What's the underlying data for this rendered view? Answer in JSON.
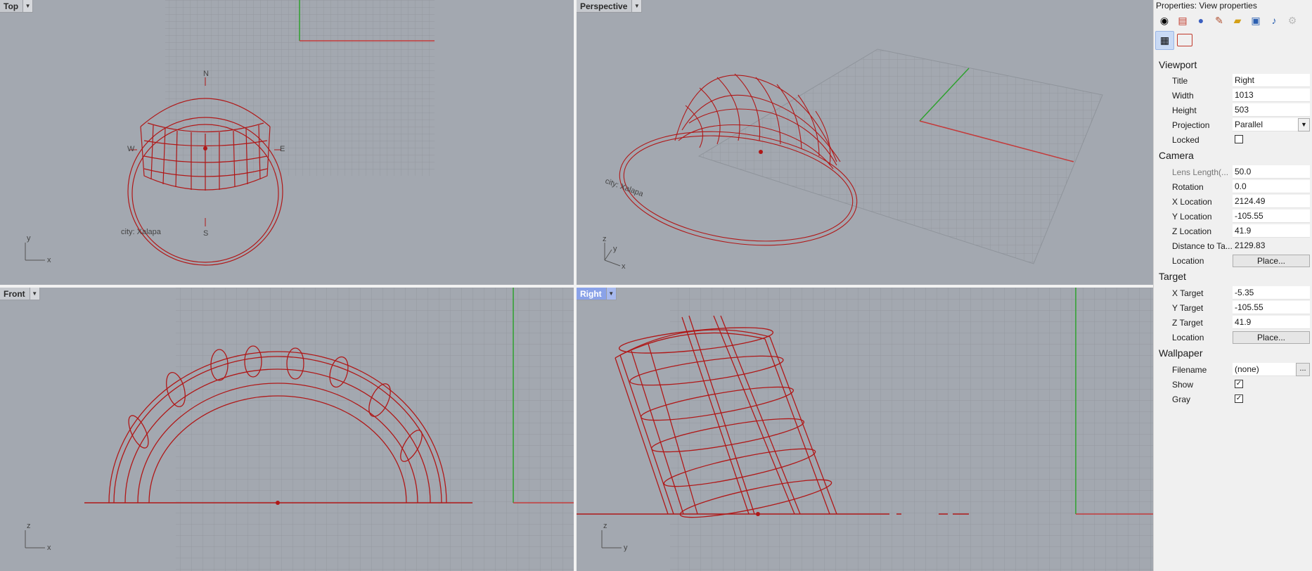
{
  "viewports": {
    "top": {
      "label": "Top",
      "city_label": "city: Xalapa",
      "axis_v": "y",
      "axis_h": "x",
      "compass": [
        "N",
        "S",
        "W",
        "E"
      ]
    },
    "perspective": {
      "label": "Perspective",
      "city_label": "city: Xalapa",
      "axis_v": "z",
      "axis_h": "x",
      "axis_y": "y"
    },
    "front": {
      "label": "Front",
      "axis_v": "z",
      "axis_h": "x"
    },
    "right": {
      "label": "Right",
      "axis_v": "z",
      "axis_h": "y"
    }
  },
  "panel": {
    "title": "Properties: View properties",
    "sections": {
      "viewport": "Viewport",
      "camera": "Camera",
      "target": "Target",
      "wallpaper": "Wallpaper"
    },
    "viewport": {
      "title_label": "Title",
      "title_value": "Right",
      "width_label": "Width",
      "width_value": "1013",
      "height_label": "Height",
      "height_value": "503",
      "projection_label": "Projection",
      "projection_value": "Parallel",
      "locked_label": "Locked",
      "locked": false
    },
    "camera": {
      "lens_label": "Lens Length(...",
      "lens_value": "50.0",
      "rotation_label": "Rotation",
      "rotation_value": "0.0",
      "xloc_label": "X Location",
      "xloc_value": "2124.49",
      "yloc_label": "Y Location",
      "yloc_value": "-105.55",
      "zloc_label": "Z Location",
      "zloc_value": "41.9",
      "dist_label": "Distance to Ta...",
      "dist_value": "2129.83",
      "location_label": "Location",
      "place_label": "Place..."
    },
    "target": {
      "xt_label": "X Target",
      "xt_value": "-5.35",
      "yt_label": "Y Target",
      "yt_value": "-105.55",
      "zt_label": "Z Target",
      "zt_value": "41.9",
      "location_label": "Location",
      "place_label": "Place..."
    },
    "wallpaper": {
      "filename_label": "Filename",
      "filename_value": "(none)",
      "browse_label": "...",
      "show_label": "Show",
      "show": true,
      "gray_label": "Gray",
      "gray": true
    }
  },
  "colors": {
    "viewport_bg": "#a3a8b0",
    "grid": "#8f949b",
    "curve": "#b01818",
    "x_axis": "#c43a3a",
    "y_axis": "#2ea12e",
    "active_tab": "#8aa2e8"
  }
}
